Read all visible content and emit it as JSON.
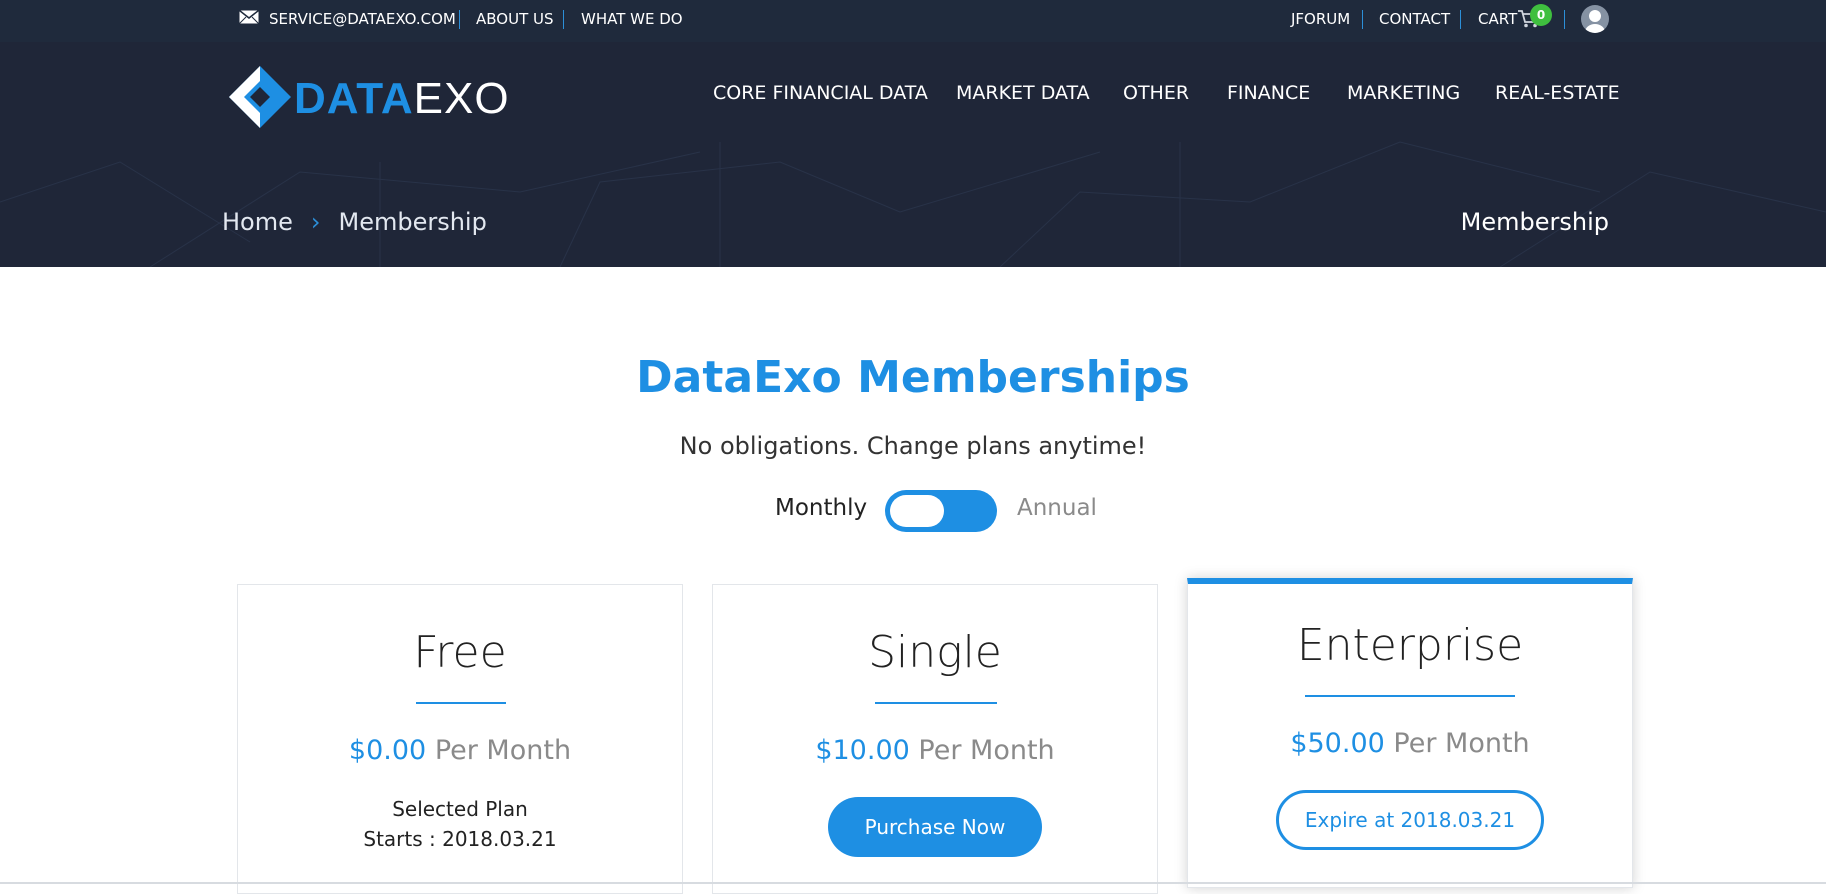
{
  "topbar": {
    "email": "SERVICE@DATAEXO.COM",
    "about": "ABOUT US",
    "what_we_do": "WHAT WE DO",
    "jforum": "JFORUM",
    "contact": "CONTACT",
    "cart": "CART",
    "cart_count": "0"
  },
  "logo": {
    "part1": "DATA",
    "part2": "EXO"
  },
  "nav": [
    "CORE FINANCIAL DATA",
    "MARKET DATA",
    "OTHER",
    "FINANCE",
    "MARKETING",
    "REAL-ESTATE"
  ],
  "breadcrumb": {
    "home": "Home",
    "separator": "›",
    "current": "Membership"
  },
  "page_heading": "Membership",
  "intro": {
    "title": "DataExo Memberships",
    "subtitle": "No obligations. Change plans anytime!",
    "toggle_left": "Monthly",
    "toggle_right": "Annual",
    "toggle_state": "Monthly"
  },
  "plans": [
    {
      "name": "Free",
      "amount": "$0.00",
      "period": "Per Month",
      "status": "Selected Plan",
      "starts": "Starts : 2018.03.21"
    },
    {
      "name": "Single",
      "amount": "$10.00",
      "period": "Per Month",
      "button": "Purchase Now"
    },
    {
      "name": "Enterprise",
      "amount": "$50.00",
      "period": "Per Month",
      "button": "Expire at 2018.03.21"
    }
  ],
  "colors": {
    "accent": "#1e8fe3",
    "topbar": "#1f2a3c",
    "header": "#1f2638",
    "badge": "#3fbf3f"
  },
  "icons": {
    "email": "envelope-icon",
    "cart": "cart-icon",
    "user": "user-avatar-icon",
    "breadcrumb": "chevron-right-icon"
  }
}
